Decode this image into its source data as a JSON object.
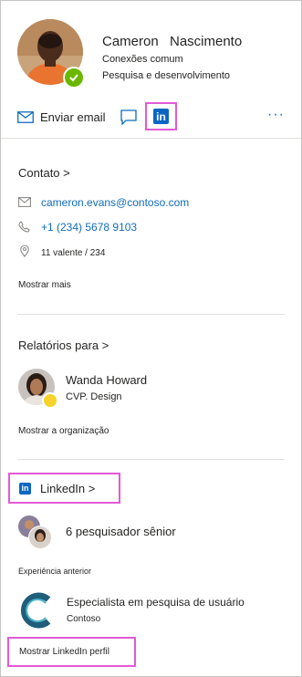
{
  "profile": {
    "first_name": "Cameron",
    "last_name": "Nascimento",
    "mutual": "Conexões comum",
    "department": "Pesquisa e desenvolvimento",
    "presence_color": "#6bb700"
  },
  "actions": {
    "email_label": "Enviar email",
    "more": "···"
  },
  "contact": {
    "title": "Contato >",
    "email": "cameron.evans@contoso.com",
    "phone": "+1 (234) 5678 9103",
    "location": "11 valente / 234",
    "show_more": "Mostrar mais"
  },
  "reports": {
    "title": "Relatórios para >",
    "manager_name": "Wanda Howard",
    "manager_title": "CVP. Design",
    "show_org": "Mostrar a organização"
  },
  "linkedin": {
    "title": "LinkedIn >",
    "logo_text": "in",
    "mutual_text": "6 pesquisador sênior",
    "prev_exp_label": "Experiência anterior",
    "job_title": "Especialista em pesquisa de usuário",
    "company": "Contoso",
    "show_profile": "Mostrar LinkedIn perfil",
    "brand_color": "#0a66c2"
  },
  "colors": {
    "accent": "#0f6cbd",
    "highlight": "#e35ad6"
  }
}
